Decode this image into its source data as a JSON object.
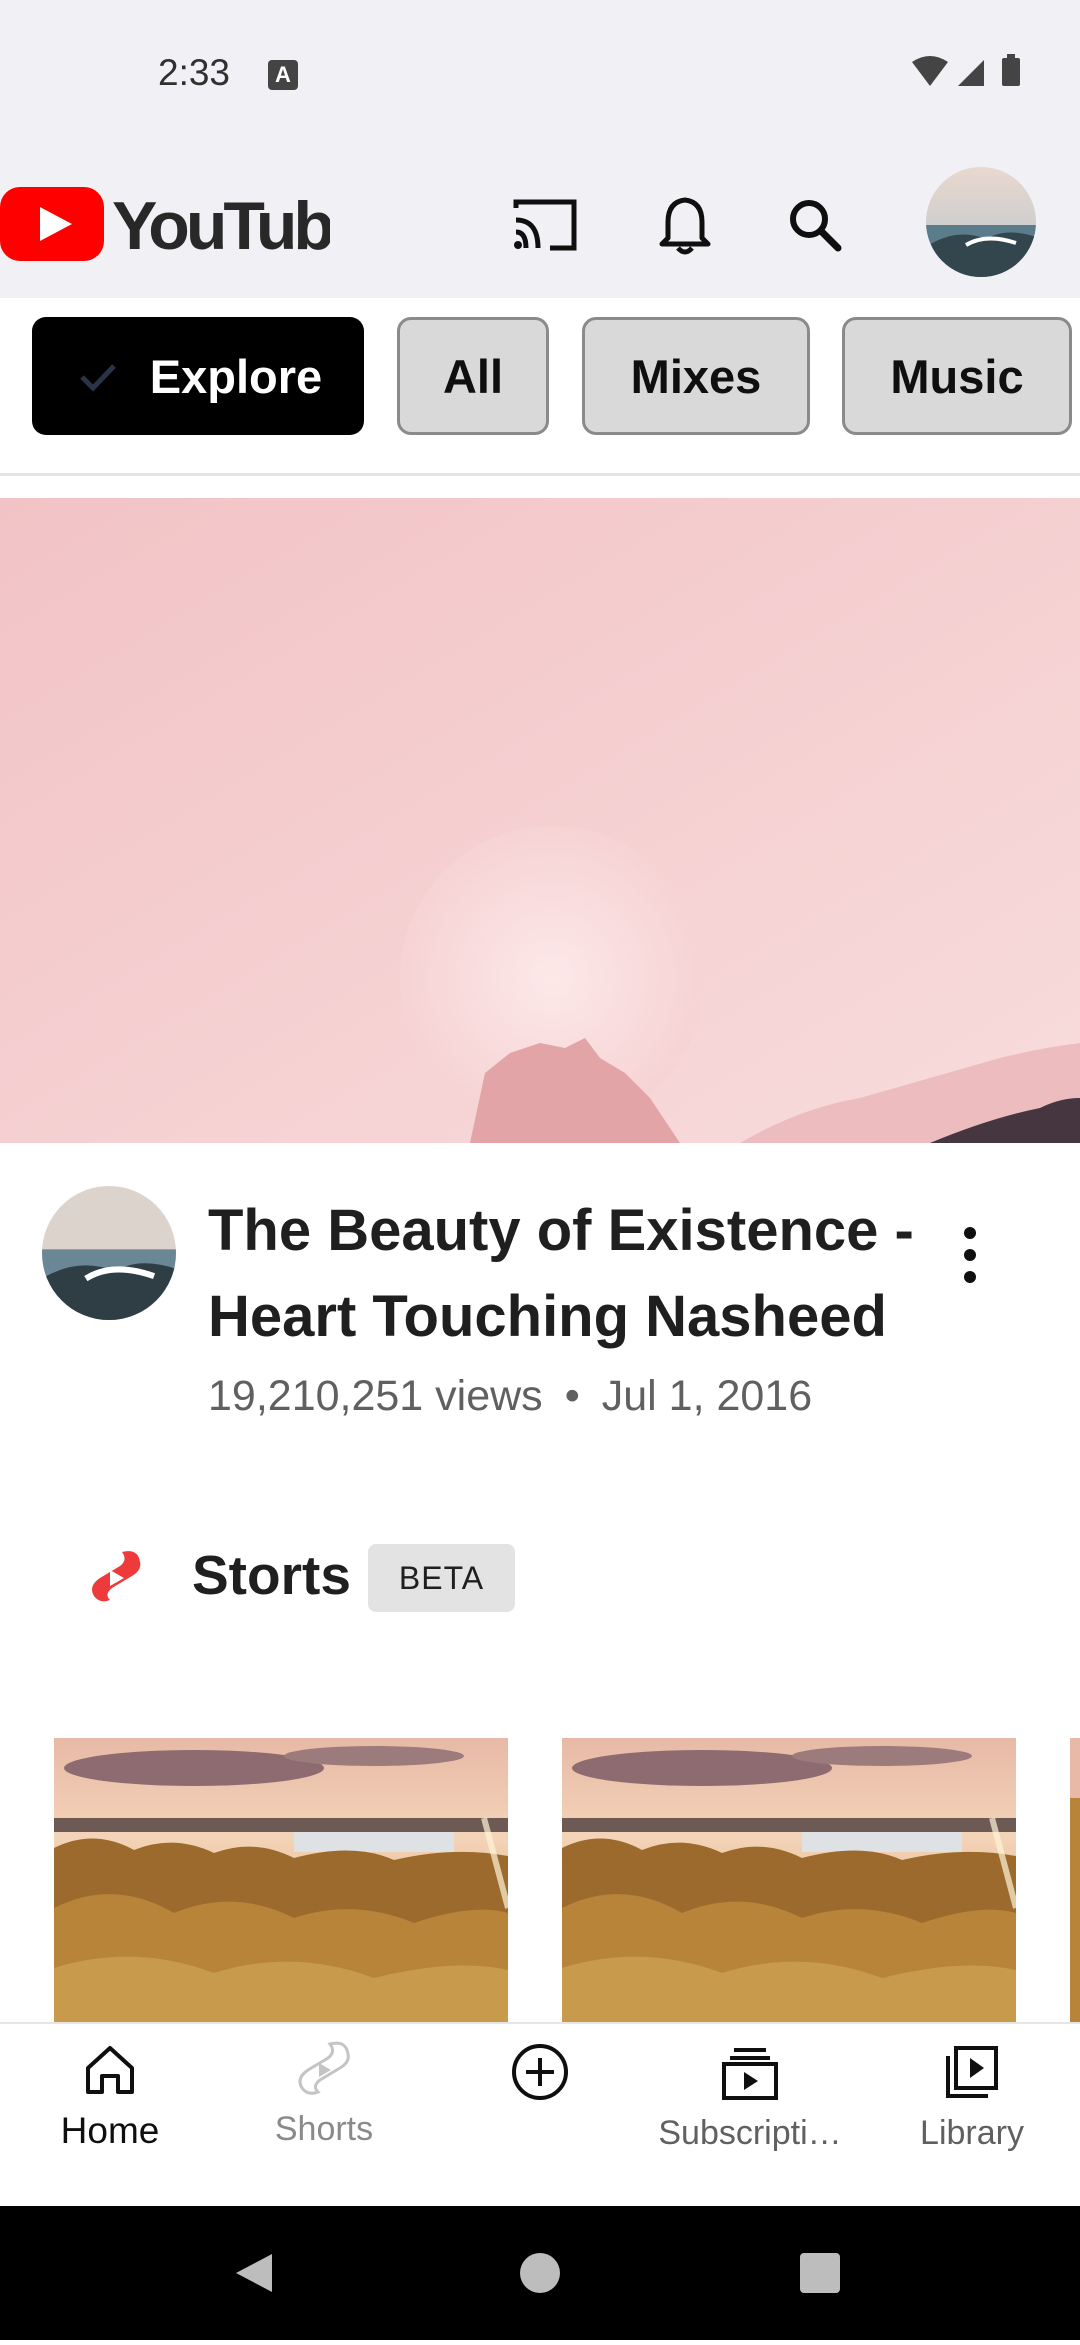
{
  "status_bar": {
    "time": "2:33",
    "notification_letter": "A",
    "icons": [
      "wifi-icon",
      "signal-icon",
      "battery-icon"
    ]
  },
  "header": {
    "logo_text": "YouTube",
    "icons": [
      "cast-icon",
      "bell-icon",
      "search-icon",
      "avatar"
    ]
  },
  "chips": [
    {
      "label": "Explore",
      "selected": true
    },
    {
      "label": "All"
    },
    {
      "label": "Mixes"
    },
    {
      "label": "Music"
    }
  ],
  "video": {
    "title": "The Beauty of Existence - Heart Touching Nasheed",
    "views": "19,210,251 views",
    "separator": "•",
    "date": "Jul 1, 2016"
  },
  "shorts": {
    "title": "Storts",
    "badge": "BETA"
  },
  "bottom_nav": {
    "home": "Home",
    "shorts": "Shorts",
    "subscriptions": "Subscripti…",
    "library": "Library"
  },
  "colors": {
    "brand_red": "#ff0000",
    "shorts_red": "#ee3a3a",
    "selected_chip": "#000000",
    "chip_gray": "#d9d9d9"
  }
}
